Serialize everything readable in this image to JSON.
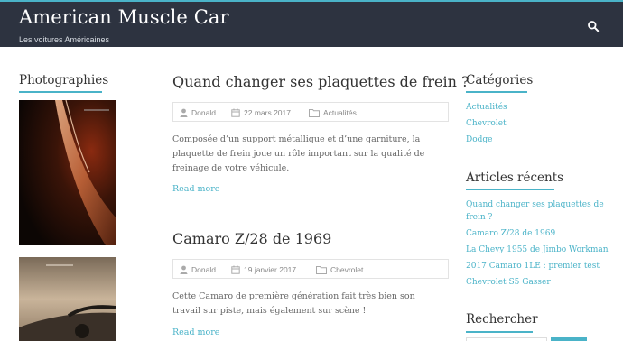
{
  "header": {
    "site_title": "American Muscle Car",
    "site_description": "Les voitures Américaines",
    "search_icon": "search-icon"
  },
  "left_sidebar": {
    "title": "Photographies"
  },
  "posts": [
    {
      "title": "Quand changer ses plaquettes de frein ?",
      "author": "Donald",
      "date": "22 mars 2017",
      "category": "Actualités",
      "excerpt": "Composée d’un support métallique et d’une garniture, la plaquette de frein joue un rôle important sur la qualité de freinage de votre véhicule.",
      "read_more": "Read more"
    },
    {
      "title": "Camaro Z/28 de 1969",
      "author": "Donald",
      "date": "19 janvier 2017",
      "category": "Chevrolet",
      "excerpt": "Cette Camaro de première génération fait très bien son travail sur piste, mais également sur scène !",
      "read_more": "Read more"
    }
  ],
  "right_sidebar": {
    "categories_title": "Catégories",
    "categories": [
      "Actualités",
      "Chevrolet",
      "Dodge"
    ],
    "recent_title": "Articles récents",
    "recent": [
      "Quand changer ses plaquettes de frein ?",
      "Camaro Z/28 de 1969",
      "La Chevy 1955 de Jimbo Workman",
      "2017 Camaro 1LE : premier test",
      "Chevrolet S5 Gasser"
    ],
    "search_title": "Rechercher"
  },
  "colors": {
    "accent": "#4ab3c8",
    "header_bg": "#2d3340"
  }
}
